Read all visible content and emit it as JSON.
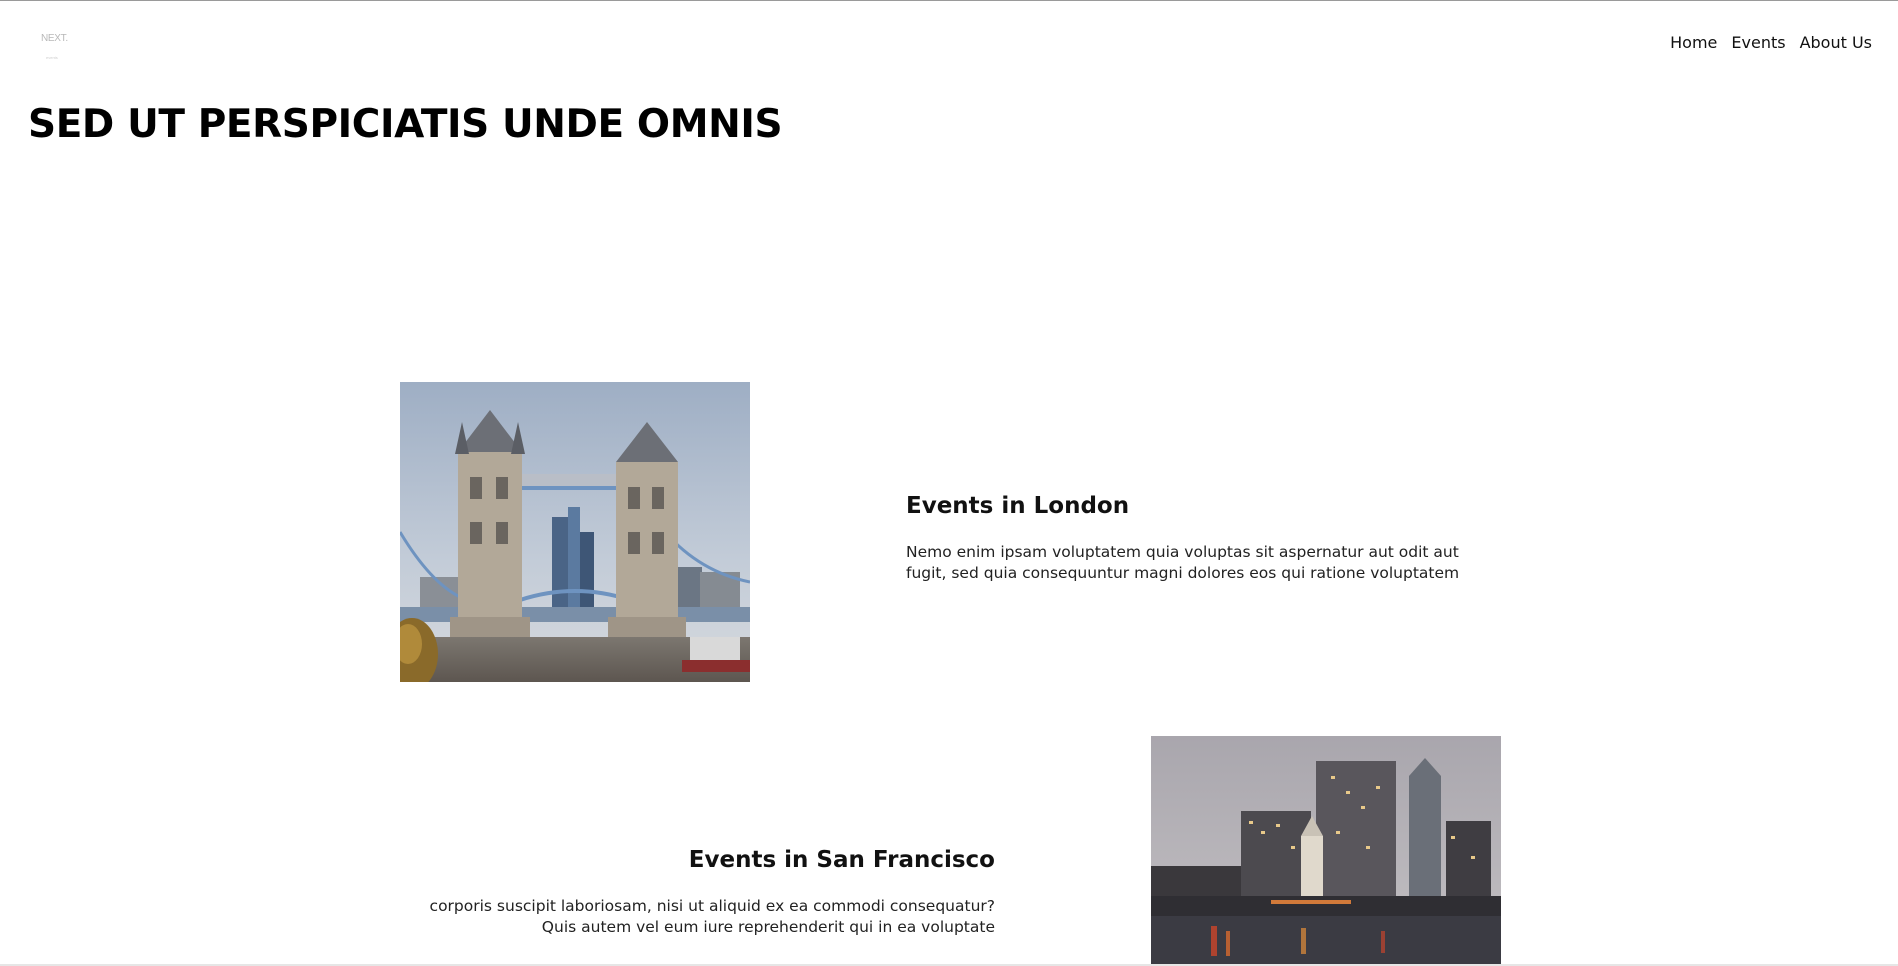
{
  "header": {
    "logo_text": "NEXT.",
    "logo_subtext": "events",
    "nav": [
      {
        "label": "Home"
      },
      {
        "label": "Events"
      },
      {
        "label": "About Us"
      }
    ]
  },
  "hero": {
    "title": "SED UT PERSPICIATIS UNDE OMNIS"
  },
  "events": [
    {
      "title": "Events in London",
      "description": "Nemo enim ipsam voluptatem quia voluptas sit aspernatur aut odit aut fugit, sed quia consequuntur magni dolores eos qui ratione voluptatem",
      "image_alt": "london-tower-bridge"
    },
    {
      "title": "Events in San Francisco",
      "description": "corporis suscipit laboriosam, nisi ut aliquid ex ea commodi consequatur? Quis autem vel eum iure reprehenderit qui in ea voluptate",
      "image_alt": "san-francisco-skyline"
    }
  ],
  "colors": {
    "text": "#111111",
    "background": "#ffffff"
  }
}
